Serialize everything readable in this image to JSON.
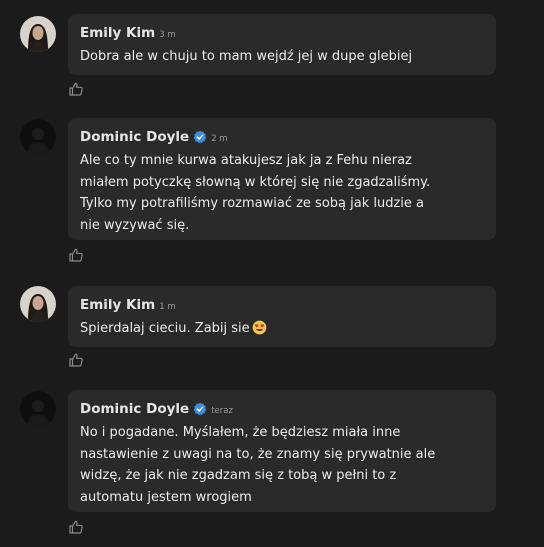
{
  "comments": [
    {
      "author": "Emily Kim",
      "verified": false,
      "time": "3 m",
      "avatar": "portrait-avatar",
      "lines": [
        "Dobra ale w chuju to mam wejdź jej w dupe glebiej"
      ]
    },
    {
      "author": "Dominic Doyle",
      "verified": true,
      "time": "2 m",
      "avatar": "dark-avatar",
      "lines": [
        "Ale co ty mnie kurwa atakujesz jak ja z Fehu nieraz",
        "miałem potyczkę słowną w której się nie zgadzaliśmy.",
        "Tylko my potrafiliśmy rozmawiać ze sobą jak ludzie a",
        "nie wyzywać się."
      ]
    },
    {
      "author": "Emily Kim",
      "verified": false,
      "time": "1 m",
      "avatar": "portrait-avatar",
      "lines": [
        "Spierdalaj cieciu. Zabij sie"
      ],
      "emoji": "smiling-face-with-heart-eyes"
    },
    {
      "author": "Dominic Doyle",
      "verified": true,
      "time": "teraz",
      "avatar": "dark-avatar",
      "lines": [
        "No i pogadane. Myślałem, że będziesz miała inne",
        "nastawienie z uwagi na to, że znamy się prywatnie ale",
        "widzę, że jak nie zgadzam się z tobą w pełni to z",
        "automatu jestem wrogiem"
      ]
    }
  ],
  "colors": {
    "background": "#1b1b1b",
    "bubble": "#2a2a2a",
    "verified_badge": "#3d8fe0",
    "muted_text": "#9a9a9a"
  }
}
